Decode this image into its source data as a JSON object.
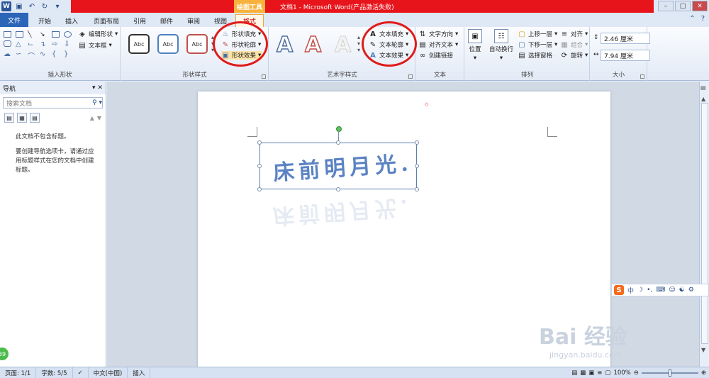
{
  "window": {
    "title": "文档1 - Microsoft Word(产品激活失败)",
    "contextual_tab": "绘图工具"
  },
  "tabs": [
    "文件",
    "开始",
    "插入",
    "页面布局",
    "引用",
    "邮件",
    "审阅",
    "视图",
    "格式"
  ],
  "ribbon": {
    "insert_shapes": {
      "edit_shape": "编辑形状",
      "text_box": "文本框",
      "label": "插入形状"
    },
    "shape_styles": {
      "preset_label": "Abc",
      "fill": "形状填充",
      "outline": "形状轮廓",
      "effects": "形状效果",
      "label": "形状样式"
    },
    "wordart_styles": {
      "letter": "A",
      "text_fill": "文本填充",
      "text_outline": "文本轮廓",
      "text_effects": "文本效果",
      "label": "艺术字样式"
    },
    "text": {
      "direction": "文字方向",
      "align": "对齐文本",
      "link": "创建链接",
      "label": "文本"
    },
    "arrange": {
      "position": "位置",
      "wrap": "自动换行",
      "bring_forward": "上移一层",
      "send_backward": "下移一层",
      "selection_pane": "选择窗格",
      "align": "对齐",
      "group": "组合",
      "rotate": "旋转",
      "label": "排列"
    },
    "size": {
      "height": "2.46 厘米",
      "width": "7.94 厘米",
      "label": "大小"
    }
  },
  "nav": {
    "title": "导航",
    "search_placeholder": "搜索文档",
    "msg1": "此文档不包含标题。",
    "msg2": "要创建导航选项卡，请通过应用标题样式在您的文档中创建标题。"
  },
  "document": {
    "textbox_text": "床前明月光."
  },
  "statusbar": {
    "page": "页面: 1/1",
    "words": "字数: 5/5",
    "language": "中文(中国)",
    "mode": "插入",
    "zoom": "100%"
  },
  "watermark": {
    "brand": "Bai 经验",
    "url": "jingyan.baidu.com"
  },
  "sogou": {
    "label": "中"
  },
  "badge": "39",
  "colors": {
    "title_bar_red": "#e8141b",
    "file_tab_blue": "#2b65b8",
    "annotation_circle": "#e01b1b",
    "wordart_blue": "#5b83c3"
  }
}
